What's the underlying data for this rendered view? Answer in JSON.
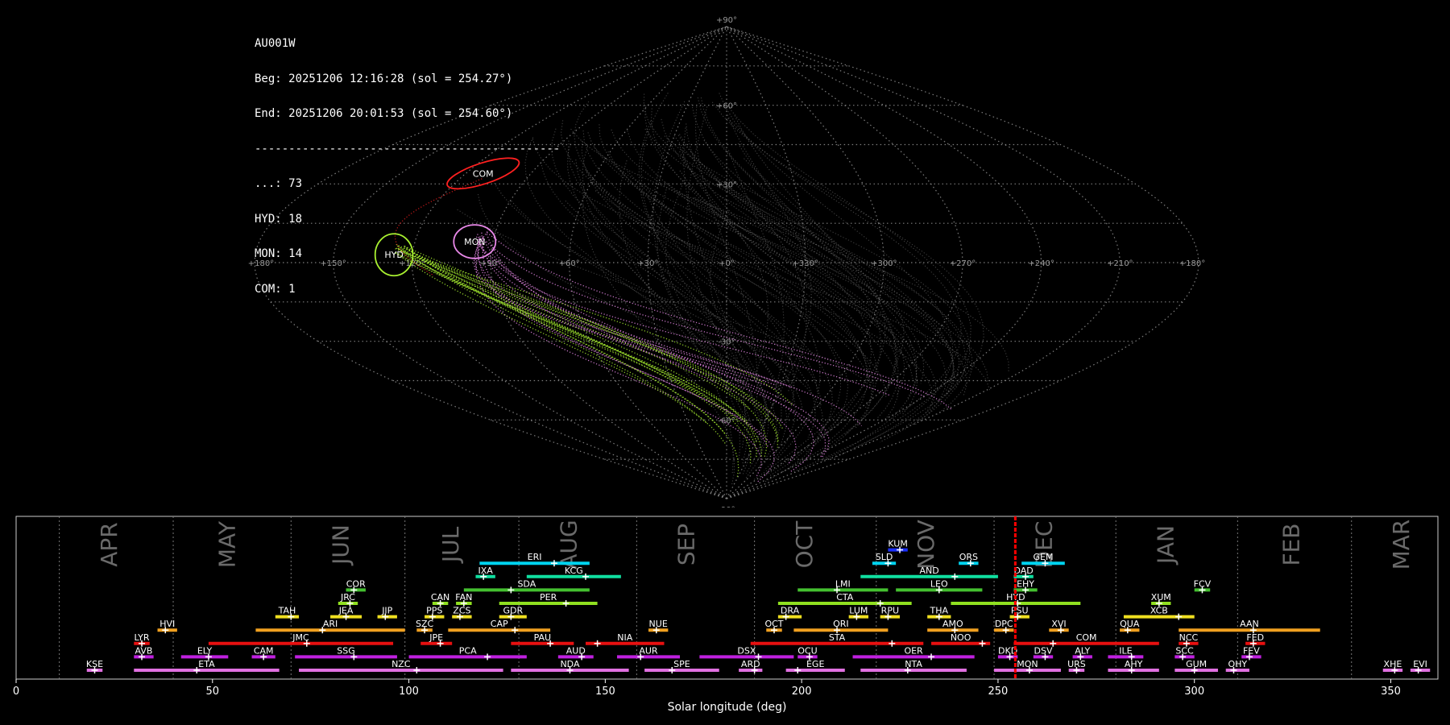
{
  "stats_box": {
    "station": "AU001W",
    "begin": "Beg: 20251206 12:16:28 (sol = 254.27°)",
    "end": "End: 20251206 20:01:53 (sol = 254.60°)",
    "separator": "---------------------------------------------",
    "counts": [
      "...: 73",
      "HYD: 18",
      "MON: 14",
      "COM: 1"
    ]
  },
  "colors": {
    "background": "#000000",
    "grid": "#8a8a8a",
    "sporadic": "#7a7a7a",
    "hyd": "#a8f030",
    "mon": "#e888e8",
    "com": "#ff2020",
    "marker": "#ff0000",
    "month_label": "#6a6a6a",
    "frame": "#cccccc"
  },
  "chart_data": [
    {
      "type": "scatter",
      "projection": "sinusoidal",
      "grid": true,
      "lon_ticks": [
        "+180°",
        "+150°",
        "+120°",
        "+90°",
        "+60°",
        "+30°",
        "+0°",
        "+330°",
        "+300°",
        "+270°",
        "+240°",
        "+210°",
        "+180°"
      ],
      "lat_ticks": [
        "+90°",
        "+60°",
        "+30°",
        "-30°",
        "-60°",
        "-90°"
      ],
      "showers": [
        {
          "code": "COM",
          "label": "COM",
          "ra_offset": -112,
          "dec": 34,
          "color": "#ff2020",
          "ellipse": true,
          "rotation": -18,
          "rx": 18,
          "ry": 5
        },
        {
          "code": "HYD",
          "label": "HYD",
          "ra_offset": -127,
          "dec": 3,
          "color": "#a8f030",
          "ellipse": true,
          "rotation": 0,
          "rx": 9,
          "ry": 10
        },
        {
          "code": "MON",
          "label": "MON",
          "ra_offset": -97,
          "dec": 8,
          "color": "#e888e8",
          "ellipse": true,
          "rotation": 0,
          "rx": 10,
          "ry": 8
        }
      ],
      "trails": {
        "sporadic": 73,
        "hyd": 18,
        "mon": 14,
        "com": 1
      }
    },
    {
      "type": "bar",
      "xlabel": "Solar longitude (deg)",
      "xlim": [
        0,
        362
      ],
      "x_ticks": [
        0,
        50,
        100,
        150,
        200,
        250,
        300,
        350
      ],
      "current_sol": 254.4,
      "months": [
        {
          "name": "APR",
          "start": 11,
          "label_at": 24
        },
        {
          "name": "MAY",
          "start": 40,
          "label_at": 54
        },
        {
          "name": "JUN",
          "start": 70,
          "label_at": 83
        },
        {
          "name": "JUL",
          "start": 99,
          "label_at": 111
        },
        {
          "name": "AUG",
          "start": 128,
          "label_at": 141
        },
        {
          "name": "SEP",
          "start": 158,
          "label_at": 171
        },
        {
          "name": "OCT",
          "start": 188,
          "label_at": 201
        },
        {
          "name": "NOV",
          "start": 219,
          "label_at": 232
        },
        {
          "name": "DEC",
          "start": 249,
          "label_at": 262
        },
        {
          "name": "JAN",
          "start": 280,
          "label_at": 293
        },
        {
          "name": "FEB",
          "start": 311,
          "label_at": 325
        },
        {
          "name": "MAR",
          "start": 340,
          "label_at": 353
        }
      ],
      "showers": [
        {
          "code": "KUM",
          "start": 222,
          "end": 227,
          "peak": 225,
          "row": 9,
          "color": "#1a2fff"
        },
        {
          "code": "ERI",
          "start": 118,
          "end": 146,
          "peak": 137,
          "row": 8,
          "color": "#00d4f0"
        },
        {
          "code": "SLD",
          "start": 218,
          "end": 224,
          "peak": 222,
          "row": 8,
          "color": "#00d4f0"
        },
        {
          "code": "ORS",
          "start": 240,
          "end": 245,
          "peak": 243,
          "row": 8,
          "color": "#00d4f0"
        },
        {
          "code": "GEM",
          "start": 256,
          "end": 267,
          "peak": 262,
          "row": 8,
          "color": "#00d4f0"
        },
        {
          "code": "IXA",
          "start": 117,
          "end": 122,
          "peak": 119,
          "row": 7,
          "color": "#10e0a0"
        },
        {
          "code": "KCG",
          "start": 130,
          "end": 154,
          "peak": 145,
          "row": 7,
          "color": "#10e0a0"
        },
        {
          "code": "AND",
          "start": 215,
          "end": 250,
          "peak": 239,
          "row": 7,
          "color": "#10e0a0"
        },
        {
          "code": "DAD",
          "start": 254,
          "end": 259,
          "peak": 257,
          "row": 7,
          "color": "#10e0a0"
        },
        {
          "code": "COR",
          "start": 84,
          "end": 89,
          "peak": 86,
          "row": 6,
          "color": "#44c030"
        },
        {
          "code": "SDA",
          "start": 114,
          "end": 146,
          "peak": 126,
          "row": 6,
          "color": "#44c030"
        },
        {
          "code": "LMI",
          "start": 199,
          "end": 222,
          "peak": 209,
          "row": 6,
          "color": "#44c030"
        },
        {
          "code": "LEO",
          "start": 224,
          "end": 246,
          "peak": 235,
          "row": 6,
          "color": "#44c030"
        },
        {
          "code": "EHY",
          "start": 254,
          "end": 260,
          "peak": 257,
          "row": 6,
          "color": "#44c030"
        },
        {
          "code": "FCV",
          "start": 300,
          "end": 304,
          "peak": 302,
          "row": 6,
          "color": "#44c030"
        },
        {
          "code": "JRC",
          "start": 82,
          "end": 87,
          "peak": 85,
          "row": 5,
          "color": "#90e020"
        },
        {
          "code": "CAN",
          "start": 106,
          "end": 110,
          "peak": 108,
          "row": 5,
          "color": "#90e020"
        },
        {
          "code": "FAN",
          "start": 112,
          "end": 116,
          "peak": 114,
          "row": 5,
          "color": "#90e020"
        },
        {
          "code": "PER",
          "start": 123,
          "end": 148,
          "peak": 140,
          "row": 5,
          "color": "#90e020"
        },
        {
          "code": "CTA",
          "start": 194,
          "end": 228,
          "peak": 220,
          "row": 5,
          "color": "#90e020"
        },
        {
          "code": "HYD",
          "start": 238,
          "end": 271,
          "peak": 255,
          "row": 5,
          "color": "#90e020"
        },
        {
          "code": "XUM",
          "start": 289,
          "end": 294,
          "peak": 291,
          "row": 5,
          "color": "#90e020"
        },
        {
          "code": "TAH",
          "start": 66,
          "end": 72,
          "peak": 70,
          "row": 4,
          "color": "#f0e020"
        },
        {
          "code": "JEA",
          "start": 80,
          "end": 88,
          "peak": 84,
          "row": 4,
          "color": "#f0e020"
        },
        {
          "code": "JIP",
          "start": 92,
          "end": 97,
          "peak": 94,
          "row": 4,
          "color": "#f0e020"
        },
        {
          "code": "PPS",
          "start": 104,
          "end": 109,
          "peak": 106,
          "row": 4,
          "color": "#f0e020"
        },
        {
          "code": "ZCS",
          "start": 111,
          "end": 116,
          "peak": 113,
          "row": 4,
          "color": "#f0e020"
        },
        {
          "code": "GDR",
          "start": 123,
          "end": 130,
          "peak": 126,
          "row": 4,
          "color": "#f0e020"
        },
        {
          "code": "DRA",
          "start": 194,
          "end": 200,
          "peak": 196,
          "row": 4,
          "color": "#f0e020"
        },
        {
          "code": "LUM",
          "start": 212,
          "end": 217,
          "peak": 214,
          "row": 4,
          "color": "#f0e020"
        },
        {
          "code": "RPU",
          "start": 220,
          "end": 225,
          "peak": 222,
          "row": 4,
          "color": "#f0e020"
        },
        {
          "code": "THA",
          "start": 232,
          "end": 238,
          "peak": 235,
          "row": 4,
          "color": "#f0e020"
        },
        {
          "code": "PSU",
          "start": 253,
          "end": 258,
          "peak": 255,
          "row": 4,
          "color": "#f0e020"
        },
        {
          "code": "XCB",
          "start": 282,
          "end": 300,
          "peak": 296,
          "row": 4,
          "color": "#f0e020"
        },
        {
          "code": "HVI",
          "start": 36,
          "end": 41,
          "peak": 38,
          "row": 3,
          "color": "#f0a020"
        },
        {
          "code": "ARI",
          "start": 61,
          "end": 99,
          "peak": 78,
          "row": 3,
          "color": "#f0a020"
        },
        {
          "code": "SZC",
          "start": 102,
          "end": 106,
          "peak": 104,
          "row": 3,
          "color": "#f0a020"
        },
        {
          "code": "CAP",
          "start": 110,
          "end": 136,
          "peak": 127,
          "row": 3,
          "color": "#f0a020"
        },
        {
          "code": "NUE",
          "start": 161,
          "end": 166,
          "peak": 163,
          "row": 3,
          "color": "#f0a020"
        },
        {
          "code": "OCT",
          "start": 191,
          "end": 195,
          "peak": 193,
          "row": 3,
          "color": "#f0a020"
        },
        {
          "code": "ORI",
          "start": 198,
          "end": 222,
          "peak": 209,
          "row": 3,
          "color": "#f0a020"
        },
        {
          "code": "AMO",
          "start": 232,
          "end": 245,
          "peak": 239,
          "row": 3,
          "color": "#f0a020"
        },
        {
          "code": "DPC",
          "start": 249,
          "end": 254,
          "peak": 252,
          "row": 3,
          "color": "#f0a020"
        },
        {
          "code": "XVI",
          "start": 263,
          "end": 268,
          "peak": 266,
          "row": 3,
          "color": "#f0a020"
        },
        {
          "code": "QUA",
          "start": 281,
          "end": 286,
          "peak": 283,
          "row": 3,
          "color": "#f0a020"
        },
        {
          "code": "AAN",
          "start": 296,
          "end": 332,
          "peak": 315,
          "row": 3,
          "color": "#f0a020"
        },
        {
          "code": "LYR",
          "start": 30,
          "end": 34,
          "peak": 32,
          "row": 2,
          "color": "#e81010"
        },
        {
          "code": "JMC",
          "start": 49,
          "end": 96,
          "peak": 74,
          "row": 2,
          "color": "#e81010"
        },
        {
          "code": "JPE",
          "start": 103,
          "end": 111,
          "peak": 108,
          "row": 2,
          "color": "#e81010"
        },
        {
          "code": "PAU",
          "start": 126,
          "end": 142,
          "peak": 136,
          "row": 2,
          "color": "#e81010"
        },
        {
          "code": "NIA",
          "start": 145,
          "end": 165,
          "peak": 148,
          "row": 2,
          "color": "#e81010"
        },
        {
          "code": "STA",
          "start": 187,
          "end": 231,
          "peak": 223,
          "row": 2,
          "color": "#e81010"
        },
        {
          "code": "NOO",
          "start": 233,
          "end": 248,
          "peak": 246,
          "row": 2,
          "color": "#e81010"
        },
        {
          "code": "COM",
          "start": 254,
          "end": 291,
          "peak": 264,
          "row": 2,
          "color": "#e81010"
        },
        {
          "code": "NCC",
          "start": 296,
          "end": 301,
          "peak": 298,
          "row": 2,
          "color": "#e81010"
        },
        {
          "code": "FED",
          "start": 313,
          "end": 318,
          "peak": 315,
          "row": 2,
          "color": "#e81010"
        },
        {
          "code": "AVB",
          "start": 30,
          "end": 35,
          "peak": 32,
          "row": 1,
          "color": "#c020e0"
        },
        {
          "code": "ELY",
          "start": 42,
          "end": 54,
          "peak": 49,
          "row": 1,
          "color": "#c020e0"
        },
        {
          "code": "CAM",
          "start": 60,
          "end": 66,
          "peak": 63,
          "row": 1,
          "color": "#c020e0"
        },
        {
          "code": "SSG",
          "start": 71,
          "end": 97,
          "peak": 86,
          "row": 1,
          "color": "#c020e0"
        },
        {
          "code": "PCA",
          "start": 100,
          "end": 130,
          "peak": 120,
          "row": 1,
          "color": "#c020e0"
        },
        {
          "code": "AUD",
          "start": 138,
          "end": 147,
          "peak": 144,
          "row": 1,
          "color": "#c020e0"
        },
        {
          "code": "AUR",
          "start": 153,
          "end": 169,
          "peak": 159,
          "row": 1,
          "color": "#c020e0"
        },
        {
          "code": "DSX",
          "start": 174,
          "end": 198,
          "peak": 189,
          "row": 1,
          "color": "#c020e0"
        },
        {
          "code": "OCU",
          "start": 199,
          "end": 204,
          "peak": 202,
          "row": 1,
          "color": "#c020e0"
        },
        {
          "code": "OER",
          "start": 213,
          "end": 244,
          "peak": 233,
          "row": 1,
          "color": "#c020e0"
        },
        {
          "code": "DKD",
          "start": 250,
          "end": 255,
          "peak": 253,
          "row": 1,
          "color": "#c020e0"
        },
        {
          "code": "DSV",
          "start": 259,
          "end": 264,
          "peak": 262,
          "row": 1,
          "color": "#c020e0"
        },
        {
          "code": "ALY",
          "start": 269,
          "end": 274,
          "peak": 271,
          "row": 1,
          "color": "#c020e0"
        },
        {
          "code": "ILE",
          "start": 278,
          "end": 287,
          "peak": 284,
          "row": 1,
          "color": "#c020e0"
        },
        {
          "code": "SCC",
          "start": 295,
          "end": 300,
          "peak": 297,
          "row": 1,
          "color": "#c020e0"
        },
        {
          "code": "FEV",
          "start": 312,
          "end": 317,
          "peak": 314,
          "row": 1,
          "color": "#c020e0"
        },
        {
          "code": "KSE",
          "start": 18,
          "end": 22,
          "peak": 20,
          "row": 0,
          "color": "#e070e0"
        },
        {
          "code": "ETA",
          "start": 30,
          "end": 67,
          "peak": 46,
          "row": 0,
          "color": "#e070e0"
        },
        {
          "code": "NZC",
          "start": 72,
          "end": 124,
          "peak": 102,
          "row": 0,
          "color": "#e070e0"
        },
        {
          "code": "NDA",
          "start": 126,
          "end": 156,
          "peak": 141,
          "row": 0,
          "color": "#e070e0"
        },
        {
          "code": "SPE",
          "start": 160,
          "end": 179,
          "peak": 167,
          "row": 0,
          "color": "#e070e0"
        },
        {
          "code": "ARD",
          "start": 184,
          "end": 190,
          "peak": 188,
          "row": 0,
          "color": "#e070e0"
        },
        {
          "code": "EGE",
          "start": 196,
          "end": 211,
          "peak": 199,
          "row": 0,
          "color": "#e070e0"
        },
        {
          "code": "NTA",
          "start": 215,
          "end": 242,
          "peak": 227,
          "row": 0,
          "color": "#e070e0"
        },
        {
          "code": "MON",
          "start": 249,
          "end": 266,
          "peak": 258,
          "row": 0,
          "color": "#e070e0"
        },
        {
          "code": "URS",
          "start": 268,
          "end": 272,
          "peak": 270,
          "row": 0,
          "color": "#e070e0"
        },
        {
          "code": "AHY",
          "start": 278,
          "end": 291,
          "peak": 284,
          "row": 0,
          "color": "#e070e0"
        },
        {
          "code": "GUM",
          "start": 295,
          "end": 306,
          "peak": 300,
          "row": 0,
          "color": "#e070e0"
        },
        {
          "code": "OHY",
          "start": 308,
          "end": 314,
          "peak": 310,
          "row": 0,
          "color": "#e070e0"
        },
        {
          "code": "XHE",
          "start": 348,
          "end": 353,
          "peak": 351,
          "row": 0,
          "color": "#e070e0"
        },
        {
          "code": "EVI",
          "start": 355,
          "end": 360,
          "peak": 357,
          "row": 0,
          "color": "#e070e0"
        }
      ]
    }
  ]
}
